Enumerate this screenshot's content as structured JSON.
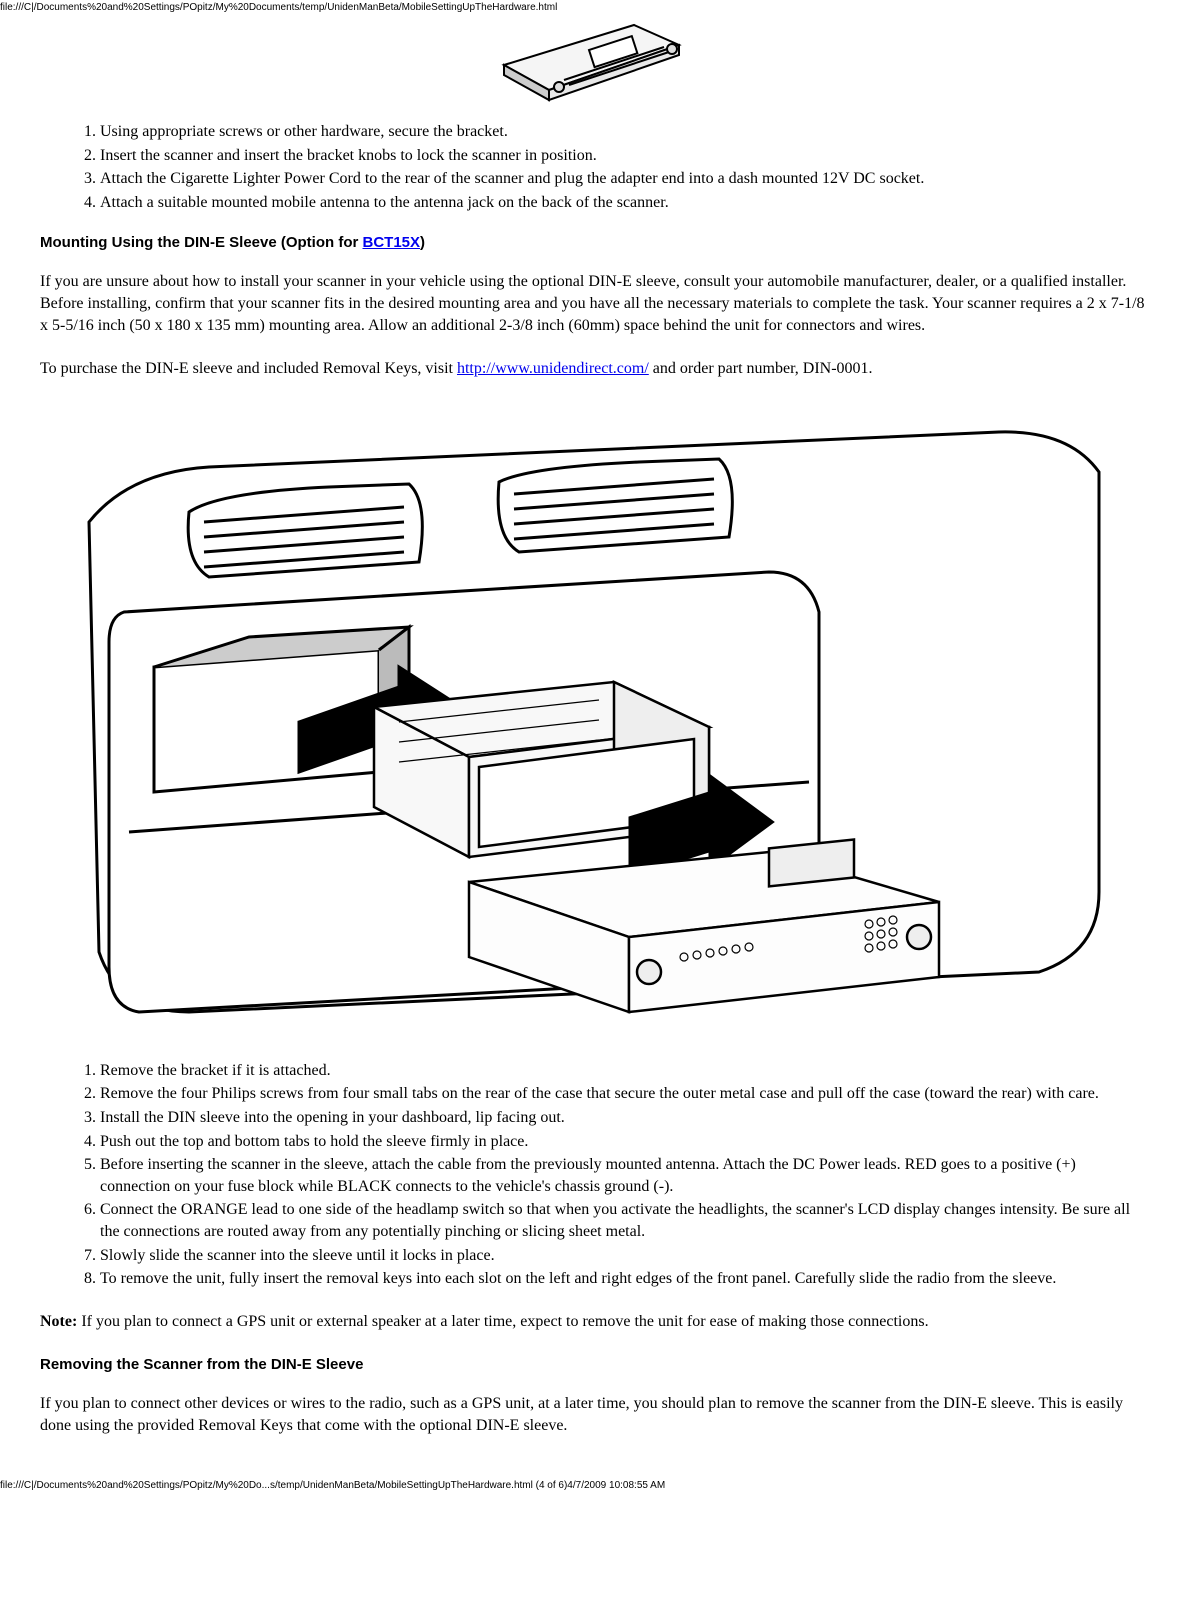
{
  "header": {
    "path": "file:///C|/Documents%20and%20Settings/POpitz/My%20Documents/temp/UnidenManBeta/MobileSettingUpTheHardware.html"
  },
  "list1": {
    "items": [
      "Using appropriate screws or other hardware, secure the bracket.",
      "Insert the scanner and insert the bracket knobs to lock the scanner in position.",
      "Attach the Cigarette Lighter Power Cord to the rear of the scanner and plug the adapter end into a dash mounted 12V DC socket.",
      "Attach a suitable mounted mobile antenna to the antenna jack on the back of the scanner."
    ]
  },
  "section1": {
    "heading_pre": "Mounting Using the DIN-E Sleeve (Option for ",
    "heading_link": "BCT15X",
    "heading_post": ")",
    "para1": "If you are unsure about how to install your scanner in your vehicle using the optional DIN-E sleeve, consult your automobile manufacturer, dealer, or a qualified installer. Before installing, confirm that your scanner fits in the desired mounting area and you have all the necessary materials to complete the task. Your scanner requires a 2 x 7-1/8 x 5-5/16 inch (50 x 180 x 135 mm) mounting area. Allow an additional 2-3/8 inch (60mm) space behind the unit for connectors and wires.",
    "para2_pre": "To purchase the DIN-E sleeve and included Removal Keys, visit ",
    "para2_link": "http://www.unidendirect.com/",
    "para2_post": " and order part number, DIN-0001."
  },
  "list2": {
    "items": [
      "Remove the bracket if it is attached.",
      "Remove the four Philips screws from four small tabs on the rear of the case that secure the outer metal case and pull off the case (toward the rear) with care.",
      "Install the DIN sleeve into the opening in your dashboard, lip facing out.",
      "Push out the top and bottom tabs to hold the sleeve firmly in place.",
      "Before inserting the scanner in the sleeve, attach the cable from the previously mounted antenna. Attach the DC Power leads. RED goes to a positive (+) connection on your fuse block while BLACK connects to the vehicle's chassis ground (-).",
      "Connect the ORANGE lead to one side of the headlamp switch so that when you activate the headlights, the scanner's LCD display changes intensity. Be sure all the connections are routed away from any potentially pinching or slicing sheet metal.",
      "Slowly slide the scanner into the sleeve until it locks in place.",
      "To remove the unit, fully insert the removal keys into each slot on the left and right edges of the front panel. Carefully slide the radio from the sleeve."
    ]
  },
  "note": {
    "label": "Note:",
    "text": " If you plan to connect a GPS unit or external speaker at a later time, expect to remove the unit for ease of making those connections."
  },
  "section2": {
    "heading": "Removing the Scanner from the DIN-E Sleeve",
    "para1": "If you plan to connect other devices or wires to the radio, such as a GPS unit, at a later time, you should plan to remove the scanner from the DIN-E sleeve. This is easily done using the provided Removal Keys that come with the optional DIN-E sleeve."
  },
  "footer": {
    "path": "file:///C|/Documents%20and%20Settings/POpitz/My%20Do...s/temp/UnidenManBeta/MobileSettingUpTheHardware.html (4 of 6)4/7/2009 10:08:55 AM"
  }
}
